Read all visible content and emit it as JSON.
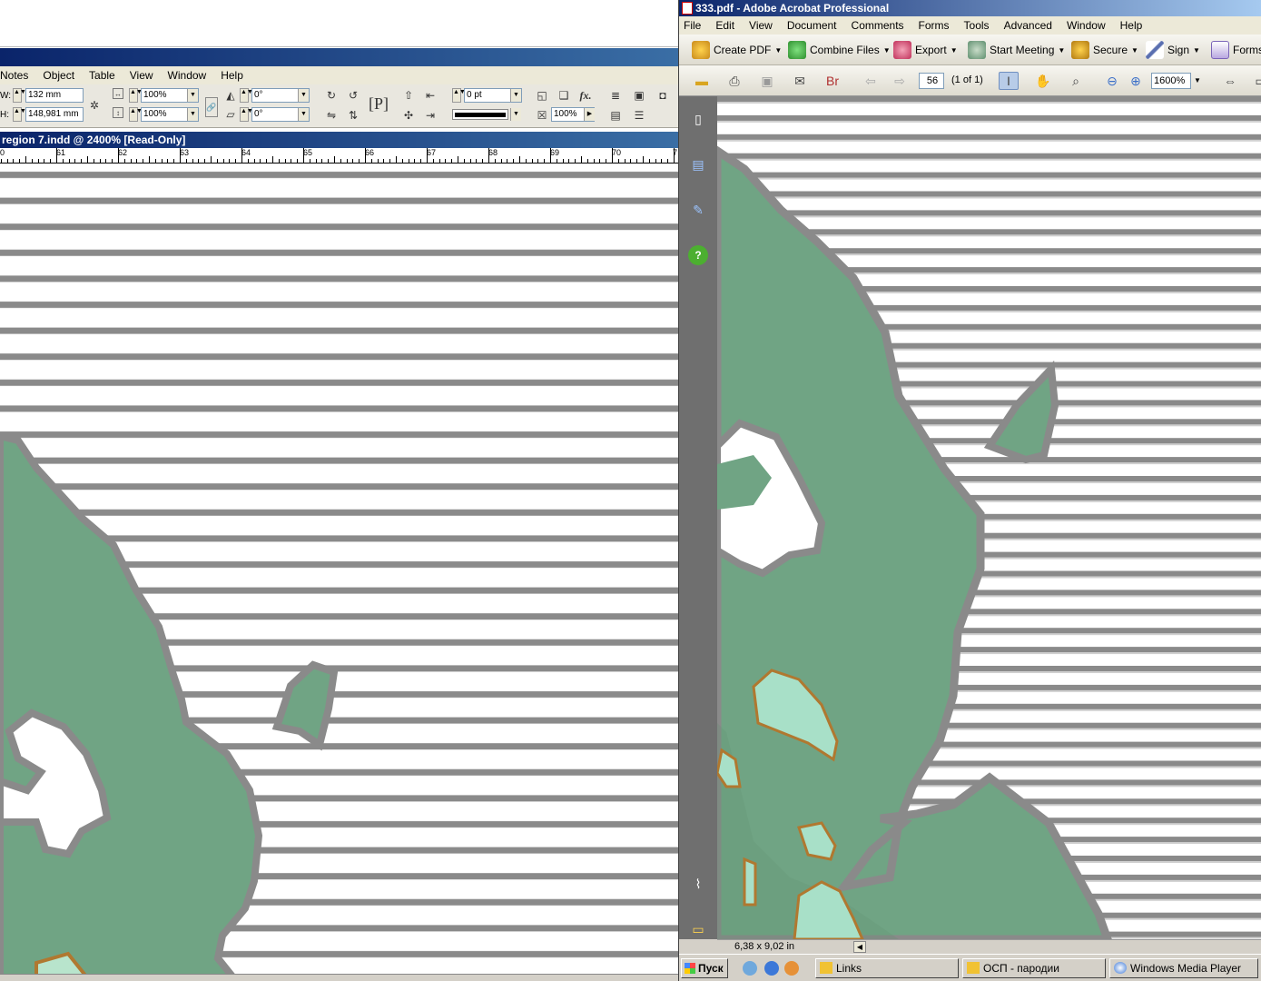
{
  "indesign": {
    "menu": [
      "Notes",
      "Object",
      "Table",
      "View",
      "Window",
      "Help"
    ],
    "control": {
      "w_label": "W:",
      "w_value": "132 mm",
      "h_label": "H:",
      "h_value": "148,981 mm",
      "scale_x": "100%",
      "scale_y": "100%",
      "rotate": "0°",
      "shear": "0°",
      "stroke_weight": "0 pt",
      "opacity": "100%"
    },
    "doc_title": "region 7.indd @ 2400% [Read-Only]",
    "ruler_labels": [
      "0",
      "61",
      "62",
      "63",
      "64",
      "65",
      "66",
      "67",
      "68",
      "69",
      "70",
      "7"
    ]
  },
  "acrobat": {
    "title": "333.pdf - Adobe Acrobat Professional",
    "menu": [
      "File",
      "Edit",
      "View",
      "Document",
      "Comments",
      "Forms",
      "Tools",
      "Advanced",
      "Window",
      "Help"
    ],
    "toolbar": {
      "create_pdf": "Create PDF",
      "combine_files": "Combine Files",
      "export": "Export",
      "start_meeting": "Start Meeting",
      "secure": "Secure",
      "sign": "Sign",
      "forms": "Forms"
    },
    "page_number": "56",
    "page_count": "(1 of 1)",
    "zoom": "1600%",
    "status_size": "6,38 x 9,02 in"
  },
  "taskbar": {
    "start": "Пуск",
    "tasks": [
      "Links",
      "ОСП - пародии",
      "Windows Media Player"
    ]
  },
  "colors": {
    "map_green": "#70a484",
    "map_outline": "#8a8a8a",
    "light_green": "#a8e0c8",
    "brown_outline": "#b07830",
    "title_blue": "#0a246a"
  }
}
